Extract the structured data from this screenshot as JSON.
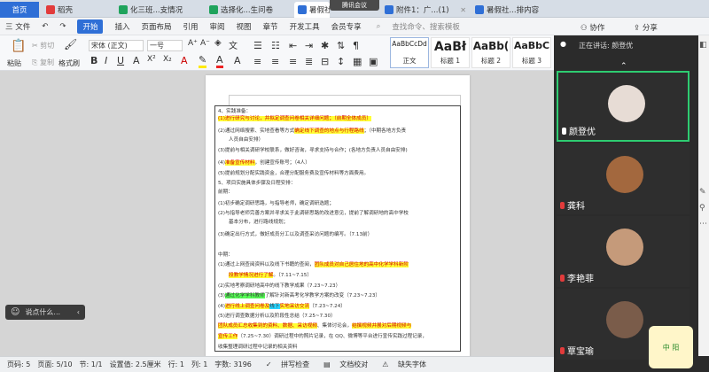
{
  "tabs": {
    "home": "首页",
    "daoke": "稻壳",
    "t1": "化三班...支情况",
    "t2": "选择化...生问卷",
    "t3": "暑假社...",
    "t4": "附件1：广...(1)",
    "t5": "暑假社...排内容",
    "add": "+",
    "search": "查找命令、搜索模板",
    "meeting": "腾讯会议"
  },
  "menu": {
    "file": "三 文件",
    "items": [
      "开始",
      "插入",
      "页面布局",
      "引用",
      "审阅",
      "视图",
      "章节",
      "开发工具",
      "会员专享"
    ],
    "collab": "协作",
    "share": "分享"
  },
  "toolbar": {
    "paste": "粘贴",
    "cut": "剪切",
    "copy": "复制",
    "format_painter": "格式刷",
    "font": "宋体 (正文)",
    "size": "一号",
    "styles": [
      {
        "preview": "AaBbCcDd",
        "name": "正文"
      },
      {
        "preview": "AaBł",
        "name": "标题 1"
      },
      {
        "preview": "AaBb(",
        "name": "标题 2"
      },
      {
        "preview": "AaBbC",
        "name": "标题 3"
      }
    ]
  },
  "meeting": {
    "speaking": "正在讲话: 颜登优",
    "participants": [
      {
        "name": "颜登优",
        "mic": "on"
      },
      {
        "name": "龚科",
        "mic": "muted"
      },
      {
        "name": "李艳菲",
        "mic": "muted"
      },
      {
        "name": "覃宝瑜",
        "mic": "muted"
      }
    ],
    "sticker": "中 阳"
  },
  "chat": {
    "placeholder": "说点什么..."
  },
  "status": {
    "page_num": "页码: 5",
    "page": "页面: 5/10",
    "section": "节: 1/1",
    "setting": "设置值: 2.5厘米",
    "row": "行: 1",
    "col": "列: 1",
    "words": "字数: 3196",
    "spell": "拼写检查",
    "proof": "文档校对",
    "missing_font": "缺失字体"
  },
  "doc": {
    "l1": "4、实践准备：",
    "l2": "(1)进行研究与讨论，并拟定调查问卷相关详细问题；（前期全体成员）",
    "l3a": "(2)通过网络搜索、实地查看等方式",
    "l3b": "确定线下调查的地点与行程路线",
    "l3c": "；（中期各地方负责",
    "l4": "人员自由安排）",
    "l5": "(3)提前与相关调研学校联系，做好咨询，寻求支持与合作；(各地方负责人员自由安排)",
    "l6a": "(4)",
    "l6b": "准备宣传材料",
    "l6c": "，创建宣传账号；（4人）",
    "l7": "(5)提前规划分配实践资金，合理分配服务费及宣传材料等方面费用。",
    "l8": "5、项目实施具体步骤及日程安排：",
    "l9": "前期：",
    "l10": "(1)初步确定调研思路，与指导老师，确定调研选题；",
    "l11": "(2)与指导老师完善方案并寻求关于此调研思路的改进意见，提前了解调研地的高中学校",
    "l12": "基本分布，进行路线规划；",
    "l13": "(3)确定出行方式，做好成员分工以及调查采访问题的编写。（7.13前）",
    "l14": "中期：",
    "l15a": "(1)通过上网查阅资料以及线下书籍的查阅，",
    "l15b": "团队成员对自己居住地的高中化学学科新阶",
    "l16a": "段教学情况进行了解",
    "l16b": "。（7.11~7.15）",
    "l17": "(2)实地考察调研地高中的线下教学成果（7.23~7.23）",
    "l18a": "(3)",
    "l18b": "通过化学学科教师",
    "l18c": "了解针对新高考化学教学方案的改变（7.23~7.23）",
    "l19a": "(4)",
    "l19b": "进行线上调查问卷及",
    "l19c": "线下",
    "l19d": "实地采访交流",
    "l19e": "（7.23~7.24）",
    "l20": "(5)进行调查数据分析以及阶段性总结（7.25~7.30）",
    "l21a": "团队成员汇总收集到的资料、数据、采访视频",
    "l21b": "、集体讨论会，",
    "l21c": "结撰视频并展对后期视频与",
    "l22a": "宣传工作",
    "l22b": "（7.25~7.30）调研过程中的照片记录，在 QQ、微博等平台进行宣传实践过程记录，",
    "l23": "收集整理调研过程中记录的相关资料"
  }
}
